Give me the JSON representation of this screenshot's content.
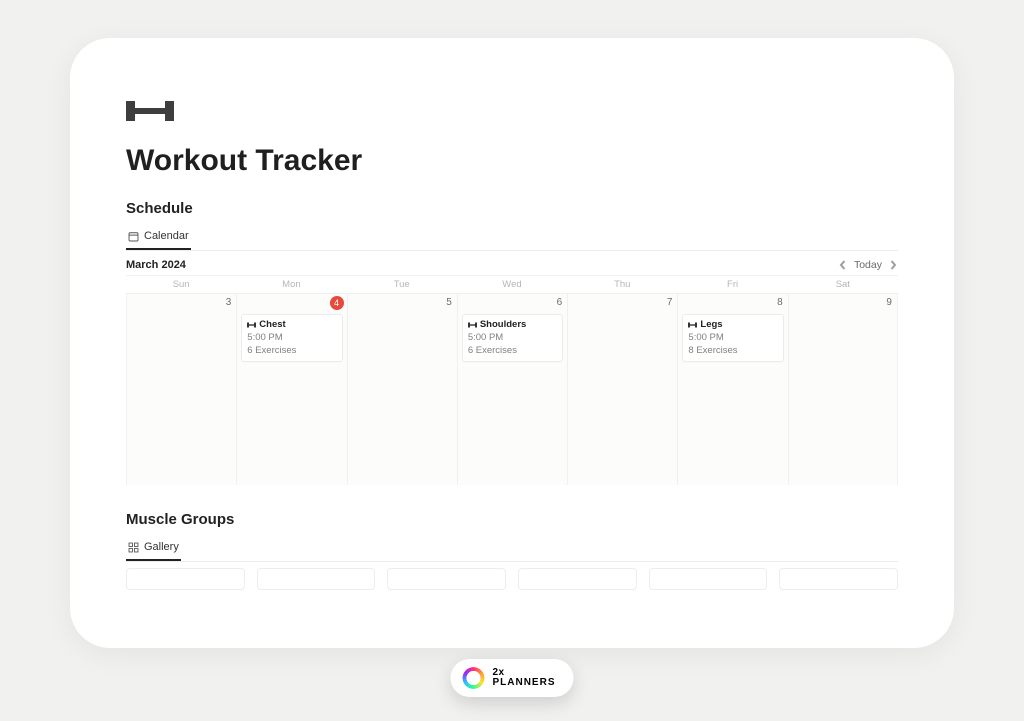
{
  "page": {
    "title": "Workout Tracker",
    "icon": "dumbbell-icon"
  },
  "schedule": {
    "heading": "Schedule",
    "tab": {
      "label": "Calendar",
      "icon": "calendar-icon"
    },
    "month": "March 2024",
    "today_label": "Today",
    "day_headers": [
      "Sun",
      "Mon",
      "Tue",
      "Wed",
      "Thu",
      "Fri",
      "Sat"
    ],
    "days": [
      {
        "date": "3",
        "is_today": false
      },
      {
        "date": "4",
        "is_today": true,
        "event": {
          "title": "Chest",
          "time": "5:00 PM",
          "meta": "6 Exercises"
        }
      },
      {
        "date": "5",
        "is_today": false
      },
      {
        "date": "6",
        "is_today": false,
        "event": {
          "title": "Shoulders",
          "time": "5:00 PM",
          "meta": "6 Exercises"
        }
      },
      {
        "date": "7",
        "is_today": false
      },
      {
        "date": "8",
        "is_today": false,
        "event": {
          "title": "Legs",
          "time": "5:00 PM",
          "meta": "8 Exercises"
        }
      },
      {
        "date": "9",
        "is_today": false
      }
    ]
  },
  "muscle_groups": {
    "heading": "Muscle Groups",
    "tab": {
      "label": "Gallery",
      "icon": "gallery-icon"
    }
  },
  "brand": {
    "line1": "2x",
    "line2": "PLANNERS"
  }
}
